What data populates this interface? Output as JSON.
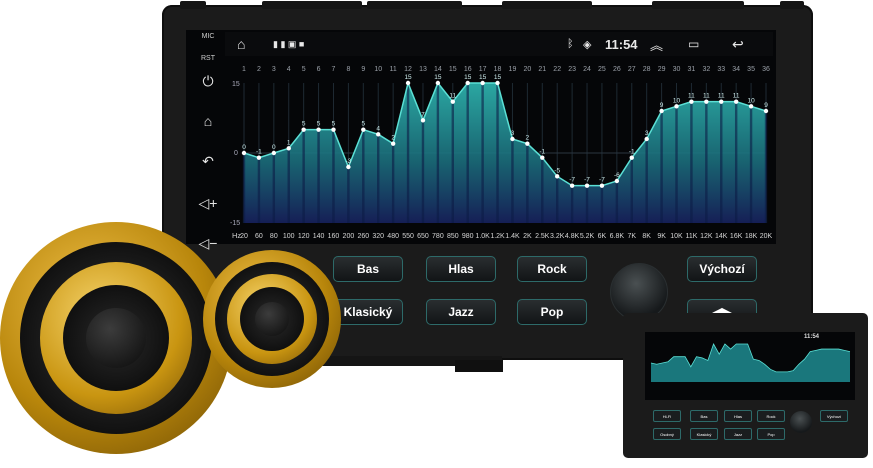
{
  "side_panel": {
    "mic_label": "MIC",
    "rst_label": "RST"
  },
  "status_bar": {
    "time": "11:54"
  },
  "equalizer": {
    "ymax_label": "15",
    "yzero_label": "0",
    "ymin_label": "-15",
    "hz_label": "Hz",
    "band_numbers": [
      "1",
      "2",
      "3",
      "4",
      "5",
      "6",
      "7",
      "8",
      "9",
      "10",
      "11",
      "12",
      "13",
      "14",
      "15",
      "16",
      "17",
      "18",
      "19",
      "20",
      "21",
      "22",
      "23",
      "24",
      "25",
      "26",
      "27",
      "28",
      "29",
      "30",
      "31",
      "32",
      "33",
      "34",
      "35",
      "36"
    ],
    "freq_labels": [
      "20",
      "60",
      "80",
      "100",
      "120",
      "140",
      "160",
      "200",
      "260",
      "320",
      "480",
      "550",
      "650",
      "780",
      "850",
      "980",
      "1.0K",
      "1.2K",
      "1.4K",
      "2K",
      "2.5K",
      "3.2K",
      "4.8K",
      "5.2K",
      "6K",
      "6.8K",
      "7K",
      "8K",
      "9K",
      "10K",
      "11K",
      "12K",
      "14K",
      "16K",
      "18K",
      "20K"
    ],
    "gains": [
      0,
      -1,
      0,
      1,
      5,
      5,
      5,
      -3,
      5,
      4,
      2,
      15,
      7,
      15,
      11,
      15,
      15,
      15,
      3,
      2,
      -1,
      -5,
      -7,
      -7,
      -7,
      -6,
      -1,
      3,
      9,
      10,
      11,
      11,
      11,
      11,
      10,
      9
    ]
  },
  "presets": {
    "bas": "Bas",
    "hlas": "Hlas",
    "rock": "Rock",
    "vychozi": "Výchozí",
    "klasicky": "Klasický",
    "jazz": "Jazz",
    "pop": "Pop"
  },
  "mini": {
    "time": "11:54",
    "buttons": [
      "Hi-Fi",
      "Bas",
      "Hlas",
      "Rock",
      "Výchozí",
      "Osobný",
      "Klasický",
      "Jazz",
      "Pop"
    ]
  },
  "colors": {
    "accent": "#33d6c8",
    "button_border": "#2d6a69"
  }
}
